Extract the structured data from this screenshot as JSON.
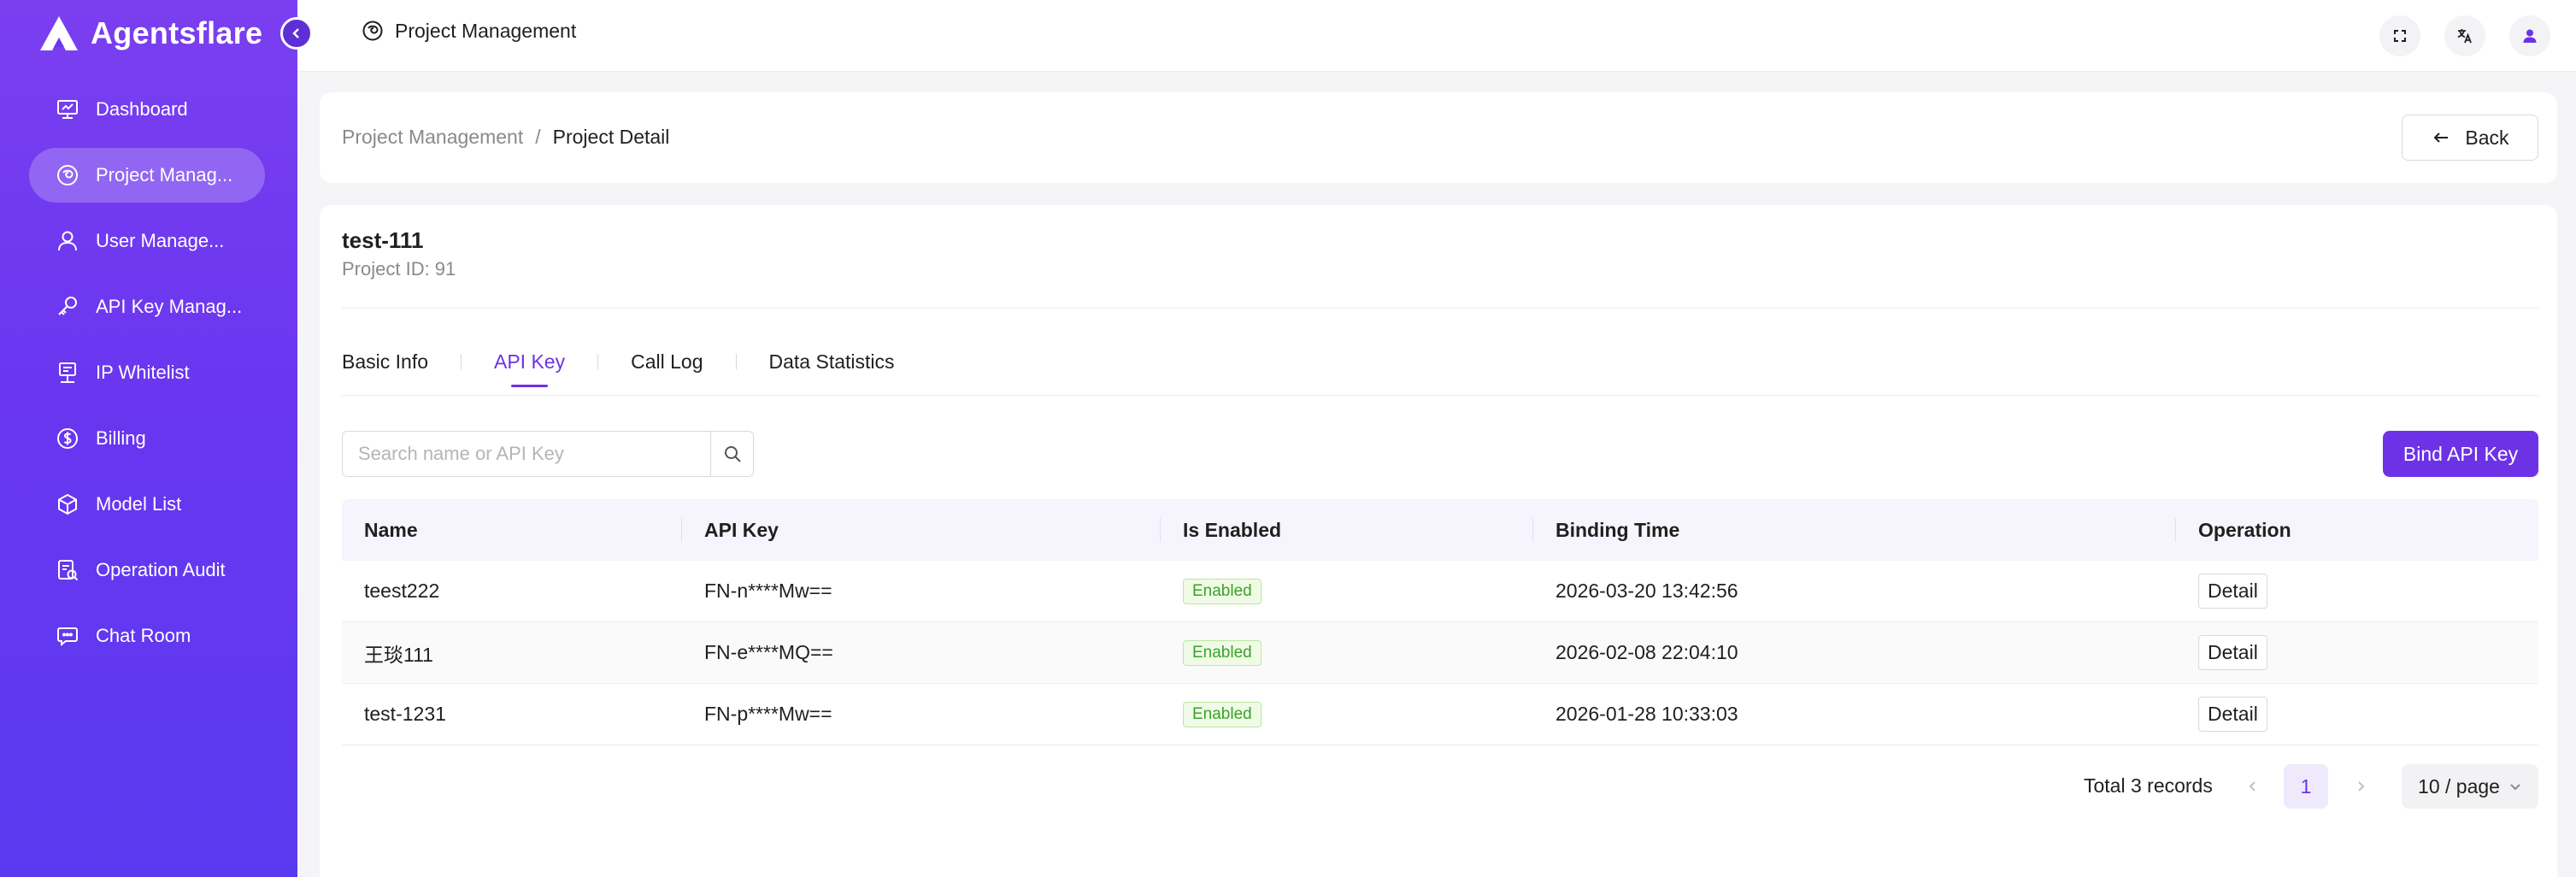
{
  "app": {
    "brand": "Agentsflare"
  },
  "colors": {
    "accent": "#6e32e6",
    "sidebar_top": "#7b3ff0",
    "sidebar_bottom": "#5a3af0",
    "enabled": "#3aa22a"
  },
  "sidebar": {
    "items": [
      {
        "label": "Dashboard",
        "icon": "dashboard-icon"
      },
      {
        "label": "Project Manag...",
        "icon": "project-icon",
        "active": true
      },
      {
        "label": "User Manage...",
        "icon": "user-icon"
      },
      {
        "label": "API Key Manag...",
        "icon": "key-icon"
      },
      {
        "label": "IP Whitelist",
        "icon": "ip-icon"
      },
      {
        "label": "Billing",
        "icon": "dollar-icon"
      },
      {
        "label": "Model List",
        "icon": "model-icon"
      },
      {
        "label": "Operation Audit",
        "icon": "audit-icon"
      },
      {
        "label": "Chat Room",
        "icon": "chat-icon"
      }
    ]
  },
  "topbar": {
    "title": "Project Management",
    "icons": [
      "fullscreen-icon",
      "translate-icon",
      "user-avatar-icon"
    ]
  },
  "breadcrumb": {
    "parent": "Project Management",
    "separator": "/",
    "current": "Project Detail"
  },
  "back_label": "Back",
  "project": {
    "name": "test-111",
    "id_text": "Project ID: 91"
  },
  "tabs": [
    {
      "label": "Basic Info"
    },
    {
      "label": "API Key",
      "active": true
    },
    {
      "label": "Call Log"
    },
    {
      "label": "Data Statistics"
    }
  ],
  "search": {
    "placeholder": "Search name or API Key",
    "value": ""
  },
  "bind_label": "Bind API Key",
  "table": {
    "columns": [
      "Name",
      "API Key",
      "Is Enabled",
      "Binding Time",
      "Operation"
    ],
    "rows": [
      {
        "name": "teest222",
        "api_key": "FN-n****Mw==",
        "status": "Enabled",
        "binding_time": "2026-03-20 13:42:56",
        "action": "Detail"
      },
      {
        "name": "王琰111",
        "api_key": "FN-e****MQ==",
        "status": "Enabled",
        "binding_time": "2026-02-08 22:04:10",
        "action": "Detail"
      },
      {
        "name": "test-1231",
        "api_key": "FN-p****Mw==",
        "status": "Enabled",
        "binding_time": "2026-01-28 10:33:03",
        "action": "Detail"
      }
    ]
  },
  "pagination": {
    "total": "Total 3 records",
    "current_page": "1",
    "page_size": "10 / page"
  }
}
